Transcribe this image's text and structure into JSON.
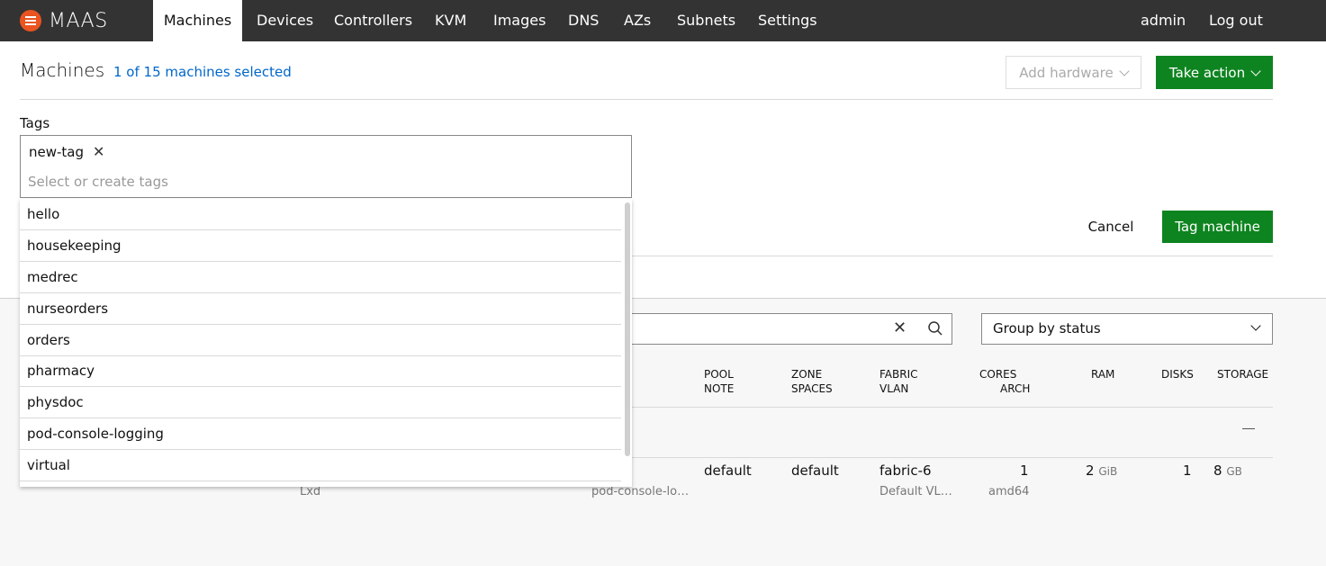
{
  "nav": {
    "brand": "MAAS",
    "items": [
      "Machines",
      "Devices",
      "Controllers",
      "KVM",
      "Images",
      "DNS",
      "AZs",
      "Subnets",
      "Settings"
    ],
    "user": "admin",
    "logout": "Log out"
  },
  "header": {
    "title": "Machines",
    "selected": "1 of 15 machines selected",
    "add_hardware": "Add hardware",
    "take_action": "Take action"
  },
  "tag_form": {
    "label": "Tags",
    "chip": "new-tag",
    "placeholder": "Select or create tags",
    "cancel": "Cancel",
    "submit": "Tag machine",
    "options": [
      "hello",
      "housekeeping",
      "medrec",
      "nurseorders",
      "orders",
      "pharmacy",
      "physdoc",
      "pod-console-logging",
      "virtual"
    ]
  },
  "filters": {
    "group_by": "Group by status"
  },
  "table": {
    "headers": {
      "pool": "POOL",
      "note": "NOTE",
      "zone": "ZONE",
      "spaces": "SPACES",
      "fabric": "FABRIC",
      "vlan": "VLAN",
      "cores": "CORES",
      "arch": "ARCH",
      "ram": "RAM",
      "disks": "DISKS",
      "storage": "STORAGE"
    },
    "row": {
      "power": "Lxd",
      "tags": "pod-console-lo…",
      "pool": "default",
      "zone": "default",
      "fabric": "fabric-6",
      "vlan": "Default VL…",
      "cores": "1",
      "arch": "amd64",
      "ram": "2",
      "ram_unit": "GiB",
      "disks": "1",
      "storage": "8",
      "storage_unit": "GB"
    }
  }
}
